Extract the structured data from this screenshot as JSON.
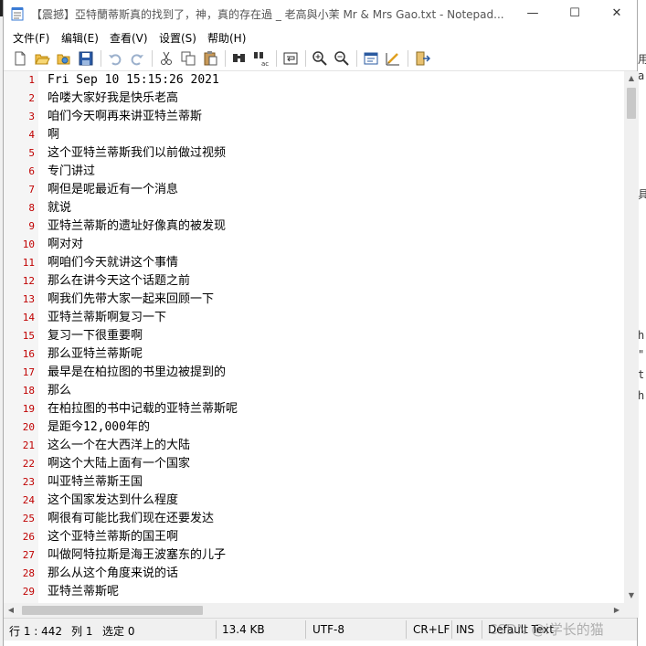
{
  "window": {
    "title": "【震撼】亞特蘭蒂斯真的找到了，神，真的存在過 _ 老高與小茉 Mr & Mrs Gao.txt - Notepad...",
    "controls": {
      "minimize": "—",
      "maximize": "☐",
      "close": "✕"
    }
  },
  "menu": {
    "items": [
      "文件(F)",
      "编辑(E)",
      "查看(V)",
      "设置(S)",
      "帮助(H)"
    ]
  },
  "toolbar": {
    "icons": [
      "new-file-icon",
      "open-folder-icon",
      "favorites-icon",
      "save-icon",
      "undo-icon",
      "redo-icon",
      "cut-icon",
      "copy-icon",
      "paste-icon",
      "find-icon",
      "replace-icon",
      "word-wrap-icon",
      "zoom-in-icon",
      "zoom-out-icon",
      "select-scheme-icon",
      "customize-scheme-icon",
      "exit-icon"
    ]
  },
  "editor": {
    "lines": [
      {
        "n": "1",
        "t": "Fri Sep 10 15:15:26 2021"
      },
      {
        "n": "2",
        "t": "哈喽大家好我是快乐老高"
      },
      {
        "n": "3",
        "t": "咱们今天啊再来讲亚特兰蒂斯"
      },
      {
        "n": "4",
        "t": "啊"
      },
      {
        "n": "5",
        "t": "这个亚特兰蒂斯我们以前做过视频"
      },
      {
        "n": "6",
        "t": "专门讲过"
      },
      {
        "n": "7",
        "t": "啊但是呢最近有一个消息"
      },
      {
        "n": "8",
        "t": "就说"
      },
      {
        "n": "9",
        "t": "亚特兰蒂斯的遗址好像真的被发现"
      },
      {
        "n": "10",
        "t": "啊对对"
      },
      {
        "n": "11",
        "t": "啊咱们今天就讲这个事情"
      },
      {
        "n": "12",
        "t": "那么在讲今天这个话题之前"
      },
      {
        "n": "13",
        "t": "啊我们先带大家一起来回顾一下"
      },
      {
        "n": "14",
        "t": "亚特兰蒂斯啊复习一下"
      },
      {
        "n": "15",
        "t": "复习一下很重要啊"
      },
      {
        "n": "16",
        "t": "那么亚特兰蒂斯呢"
      },
      {
        "n": "17",
        "t": "最早是在柏拉图的书里边被提到的"
      },
      {
        "n": "18",
        "t": "那么"
      },
      {
        "n": "19",
        "t": "在柏拉图的书中记载的亚特兰蒂斯呢"
      },
      {
        "n": "20",
        "t": "是距今12,000年的"
      },
      {
        "n": "21",
        "t": "这么一个在大西洋上的大陆"
      },
      {
        "n": "22",
        "t": "啊这个大陆上面有一个国家"
      },
      {
        "n": "23",
        "t": "叫亚特兰蒂斯王国"
      },
      {
        "n": "24",
        "t": "这个国家发达到什么程度"
      },
      {
        "n": "25",
        "t": "啊很有可能比我们现在还要发达"
      },
      {
        "n": "26",
        "t": "这个亚特兰蒂斯的国王啊"
      },
      {
        "n": "27",
        "t": "叫做阿特拉斯是海王波塞东的儿子"
      },
      {
        "n": "28",
        "t": "那么从这个角度来说的话"
      },
      {
        "n": "29",
        "t": "亚特兰蒂斯呢"
      }
    ]
  },
  "status": {
    "position": "行 1 : 442",
    "column": "列 1",
    "selection": "选定 0",
    "size": "13.4 KB",
    "encoding": "UTF-8",
    "eol": "CR+LF",
    "mode": "INS",
    "scheme": "Default Text"
  },
  "watermark": "CSDN @i学长的猫",
  "background_fragments": [
    "用",
    "a",
    "具",
    "h",
    "\"",
    "t",
    "h"
  ]
}
